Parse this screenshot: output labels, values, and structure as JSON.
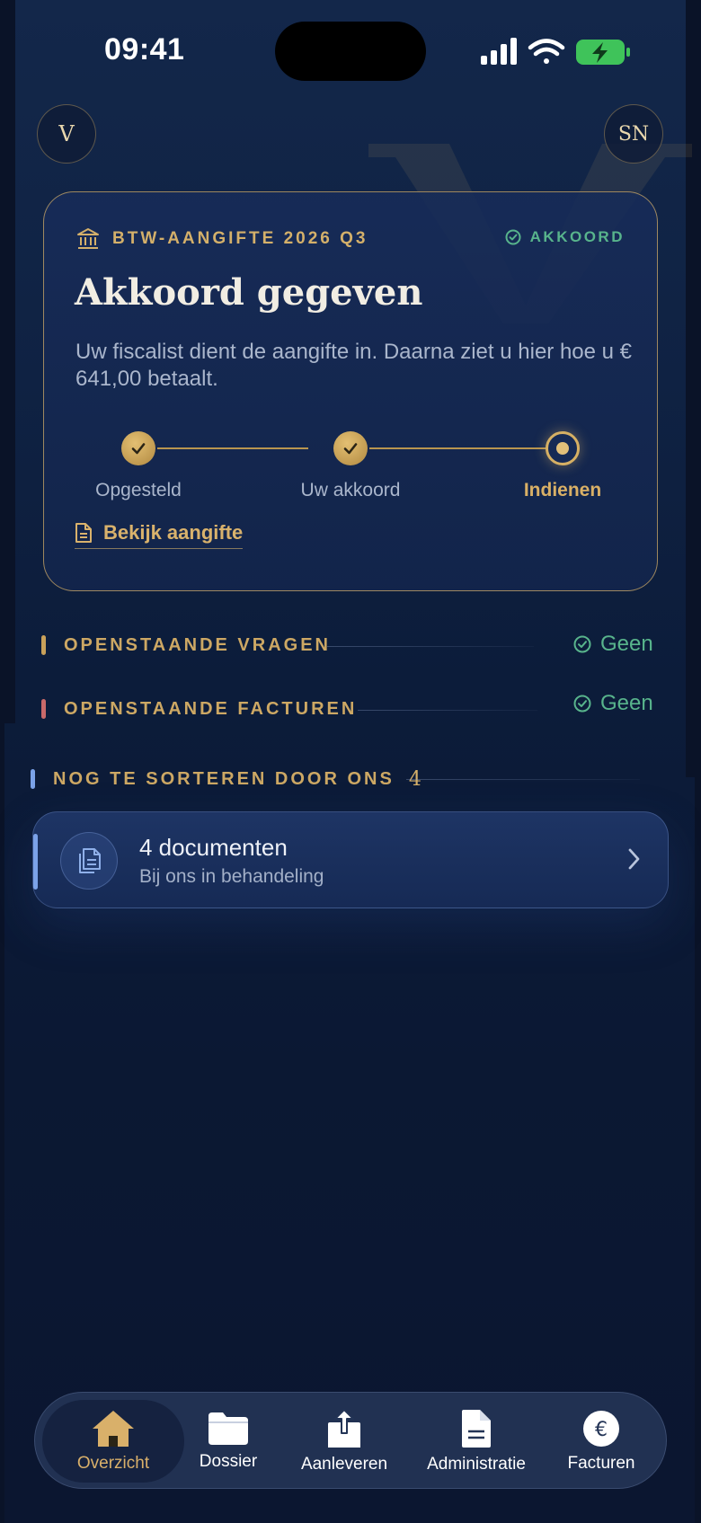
{
  "status_bar": {
    "time": "09:41"
  },
  "header": {
    "logo_text": "V",
    "avatar_initials": "SN"
  },
  "tax_card": {
    "eyebrow": "BTW-AANGIFTE 2026 Q3",
    "status": "AKKOORD",
    "title": "Akkoord gegeven",
    "description": "Uw fiscalist dient de aangifte in. Daarna ziet u hier hoe u € 641,00 betaalt.",
    "steps": [
      {
        "label": "Opgesteld",
        "state": "done"
      },
      {
        "label": "Uw akkoord",
        "state": "done"
      },
      {
        "label": "Indienen",
        "state": "current"
      }
    ],
    "link": "Bekijk aangifte"
  },
  "sections": {
    "open_questions": {
      "title": "OPENSTAANDE VRAGEN",
      "status": "Geen",
      "accent": "#c9a15a"
    },
    "open_invoices": {
      "title": "OPENSTAANDE FACTUREN",
      "status": "Geen",
      "accent": "#c96a6a"
    },
    "to_sort": {
      "title": "NOG TE SORTEREN DOOR ONS",
      "count": "4",
      "accent": "#7ba2e8"
    }
  },
  "documents_card": {
    "title": "4 documenten",
    "subtitle": "Bij ons in behandeling"
  },
  "tabbar": {
    "tabs": [
      {
        "label": "Overzicht",
        "icon": "home-icon",
        "active": true
      },
      {
        "label": "Dossier",
        "icon": "folder-icon",
        "active": false
      },
      {
        "label": "Aanleveren",
        "icon": "upload-icon",
        "active": false
      },
      {
        "label": "Administratie",
        "icon": "document-icon",
        "active": false
      },
      {
        "label": "Facturen",
        "icon": "euro-icon",
        "active": false
      }
    ]
  },
  "colors": {
    "gold": "#d4b06a",
    "success": "#58b48c",
    "background": "#0f2243",
    "blue_accent": "#7ba2e8"
  }
}
